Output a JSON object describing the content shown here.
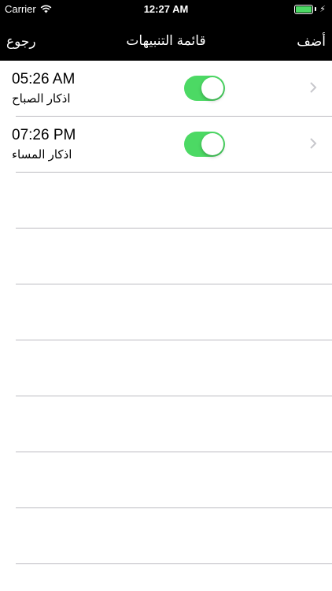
{
  "status_bar": {
    "carrier": "Carrier",
    "time": "12:27 AM",
    "battery_color": "#4cd964"
  },
  "nav_bar": {
    "back_label": "رجوع",
    "title": "قائمة التنبيهات",
    "add_label": "أضف"
  },
  "alarms": [
    {
      "time": "05:26 AM",
      "name": "اذكار الصباح",
      "enabled": true
    },
    {
      "time": "07:26 PM",
      "name": "اذكار المساء",
      "enabled": true
    }
  ],
  "colors": {
    "switch_on": "#4cd964",
    "separator": "#bcbbc1",
    "chevron": "#c7c7cc"
  }
}
